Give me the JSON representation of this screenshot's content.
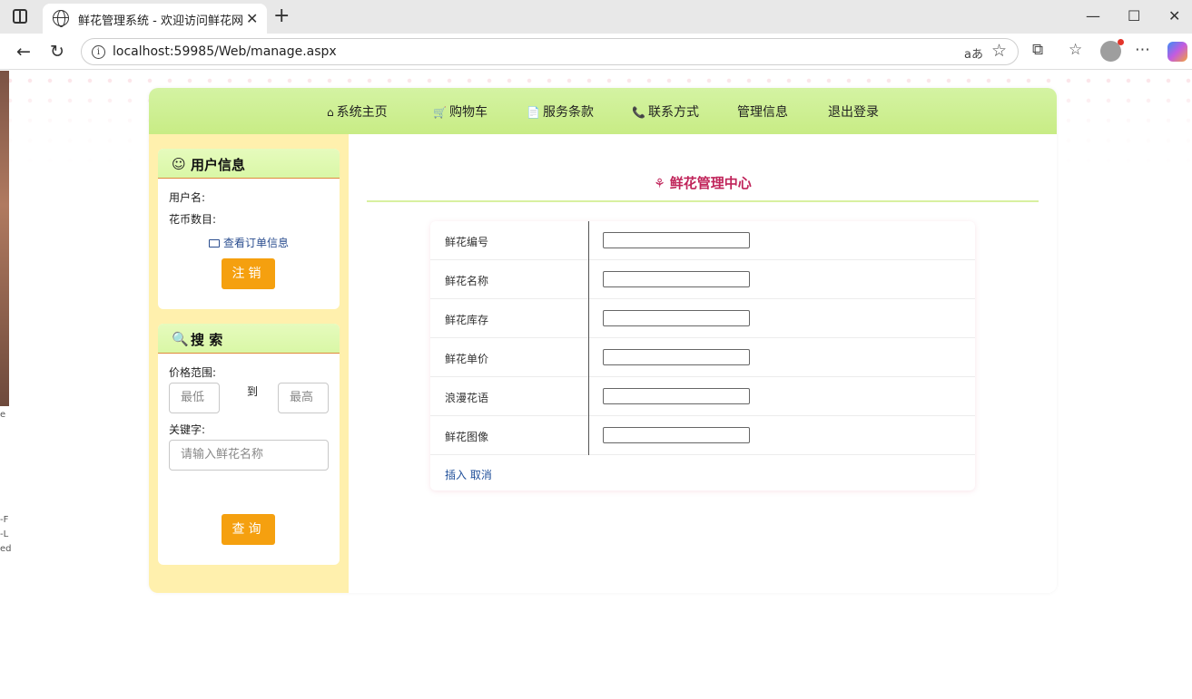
{
  "browser": {
    "tab_title": "鲜花管理系统 - 欢迎访问鲜花网上",
    "tab_close": "✕",
    "new_tab": "+",
    "url": "localhost:59985/Web/manage.aspx",
    "read_aloud": "aあ",
    "window_controls": {
      "minimize": "—",
      "maximize": "☐",
      "close": "✕"
    },
    "icons": [
      "tab-actions-icon",
      "globe-icon",
      "back-icon",
      "refresh-icon",
      "info-icon",
      "read-aloud-icon",
      "star-icon",
      "extensions-icon",
      "favorites-icon",
      "profile-avatar",
      "more-icon",
      "copilot-icon"
    ]
  },
  "left_fragments": [
    "e",
    "-F",
    "-L",
    "ed"
  ],
  "nav": {
    "items": [
      {
        "icon": "home-icon",
        "glyph": "⌂",
        "label": "系统主页"
      },
      {
        "icon": "cart-icon",
        "glyph": "🛒",
        "label": "购物车"
      },
      {
        "icon": "document-icon",
        "glyph": "📄",
        "label": "服务条款"
      },
      {
        "icon": "phone-icon",
        "glyph": "📞",
        "label": "联系方式"
      },
      {
        "icon": "",
        "glyph": "",
        "label": "管理信息"
      },
      {
        "icon": "",
        "glyph": "",
        "label": "退出登录"
      }
    ]
  },
  "user_panel": {
    "icon": "user-circle-icon",
    "title": "用户信息",
    "username_label": "用户名:",
    "coins_label": "花币数目:",
    "order_link": "查看订单信息",
    "logout_button": "注销"
  },
  "search_panel": {
    "icon": "search-icon",
    "title": "搜 索",
    "price_label": "价格范围:",
    "min_placeholder": "最低",
    "to_label": "到",
    "max_placeholder": "最高",
    "keyword_label": "关键字:",
    "keyword_placeholder": "请输入鲜花名称",
    "query_button": "查询"
  },
  "main": {
    "title_icon": "flower-icon",
    "title": "鲜花管理中心",
    "fields": [
      {
        "label": "鲜花编号",
        "value": ""
      },
      {
        "label": "鲜花名称",
        "value": ""
      },
      {
        "label": "鲜花库存",
        "value": ""
      },
      {
        "label": "鲜花单价",
        "value": ""
      },
      {
        "label": "浪漫花语",
        "value": ""
      },
      {
        "label": "鲜花图像",
        "value": ""
      }
    ],
    "insert_link": "插入",
    "cancel_link": "取消"
  },
  "colors": {
    "nav_bg": "#c8ec85",
    "sidebar_bg": "#fff0ad",
    "button_orange": "#f5a00f",
    "title_red": "#c0245a",
    "link_blue": "#1f4f9a"
  }
}
